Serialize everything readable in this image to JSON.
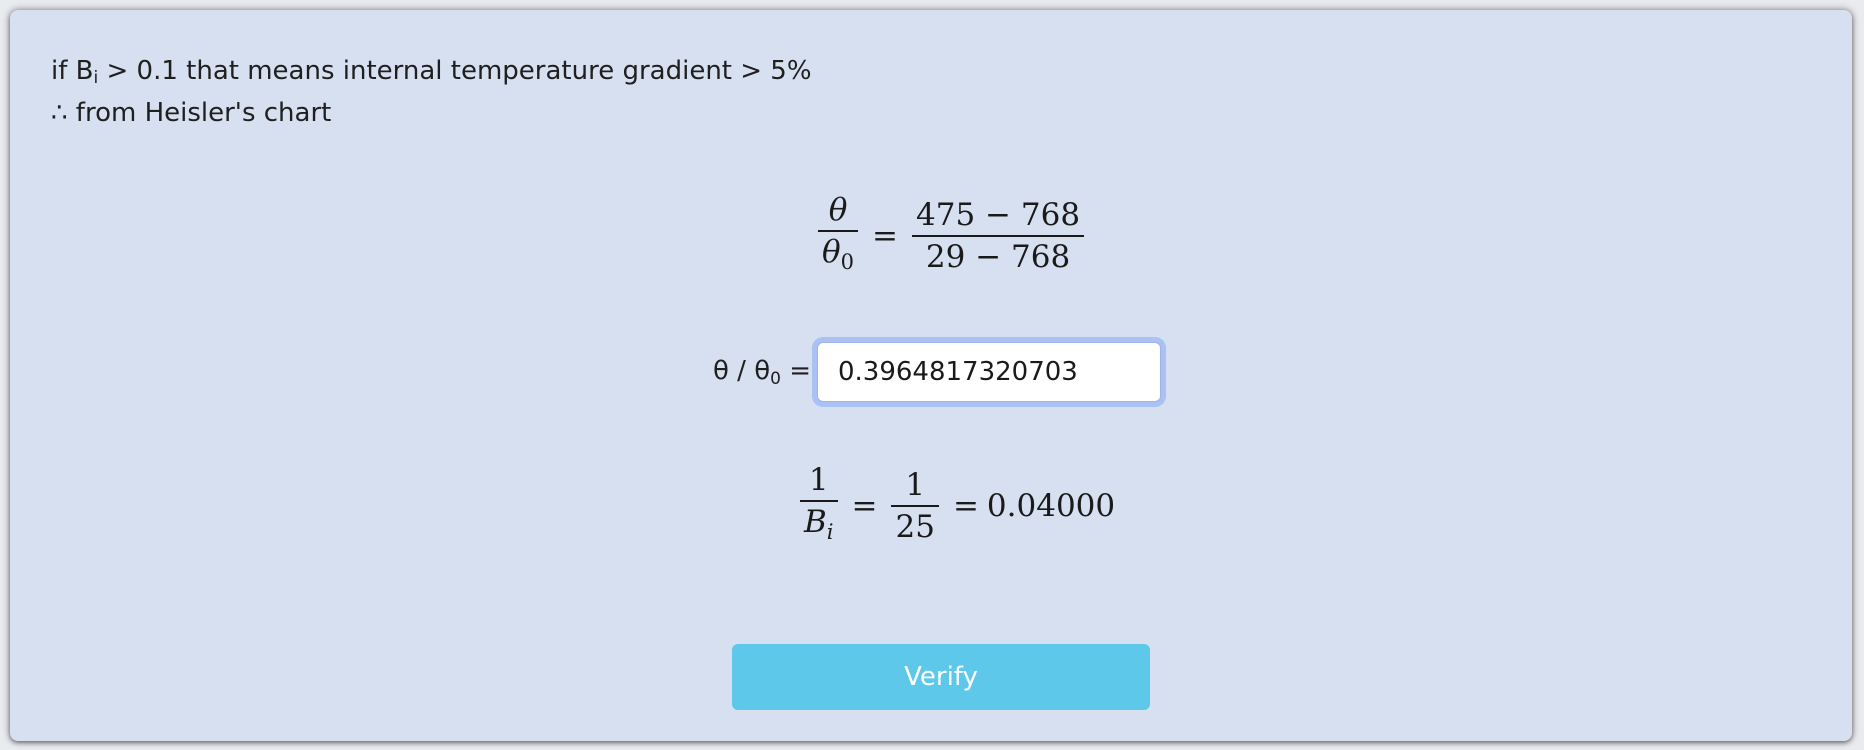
{
  "intro": {
    "line1_prefix": "if B",
    "line1_sub": "i",
    "line1_suffix": " > 0.1 that means internal temperature gradient > 5%",
    "line2": "∴ from Heisler's chart"
  },
  "equation1": {
    "lhs_num": "θ",
    "lhs_den_main": "θ",
    "lhs_den_sub": "0",
    "equals": "=",
    "rhs_num": "475 − 768",
    "rhs_den": "29 − 768"
  },
  "ratio_input": {
    "label_prefix": "θ / θ",
    "label_sub": "0",
    "label_suffix": " =",
    "value": "0.3964817320703"
  },
  "equation2": {
    "frac1_num": "1",
    "frac1_den_main": "B",
    "frac1_den_sub": "i",
    "equals1": "=",
    "frac2_num": "1",
    "frac2_den": "25",
    "equals2": "=",
    "result": "0.04000"
  },
  "actions": {
    "verify_label": "Verify"
  },
  "colors": {
    "panel_bg": "#d6e0f0",
    "verify_button": "#5ec8eb",
    "input_focus_ring": "#a9c1f3"
  }
}
